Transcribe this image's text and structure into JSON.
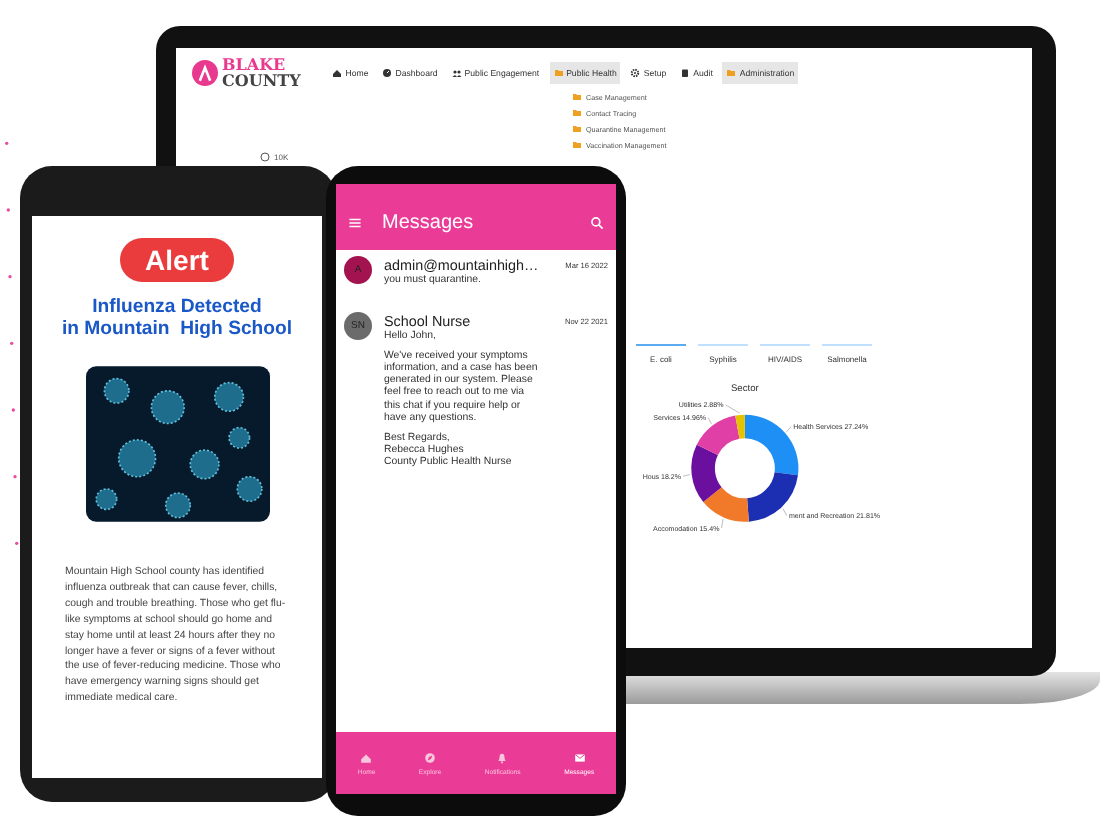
{
  "laptop": {
    "logo": {
      "line_1": "BLAKE",
      "line_2": "COUNTY"
    },
    "nav": [
      {
        "label": "Home",
        "selected": false
      },
      {
        "label": "Dashboard",
        "selected": false
      },
      {
        "label": "Public Engagement",
        "selected": false
      },
      {
        "label": "Public Health",
        "selected": true
      },
      {
        "label": "Setup",
        "selected": false
      },
      {
        "label": "Audit",
        "selected": false
      },
      {
        "label": "Administration",
        "selected": true
      }
    ],
    "dropdown": [
      "Case Management",
      "Contact Tracing",
      "Quarantine Management",
      "Vaccination Management"
    ],
    "stat_label": "10K",
    "tabs": [
      {
        "label": "E. coli",
        "selected": true
      },
      {
        "label": "Syphilis",
        "selected": false
      },
      {
        "label": "HIV/AIDS",
        "selected": false
      },
      {
        "label": "Salmonella",
        "selected": false
      }
    ],
    "chart_data": {
      "type": "donut",
      "title": "Sector",
      "categories": [
        "Health Services",
        "ment and Recreation",
        "Accomodation",
        "Hous",
        "Services",
        "Utilities"
      ],
      "values": [
        27.24,
        21.81,
        15.4,
        18.2,
        14.96,
        2.88
      ],
      "value_labels": [
        "27.24%",
        "21.81%",
        "15.4%",
        "18.2%",
        "14.96%",
        "2.88%"
      ]
    }
  },
  "alert_phone": {
    "badge": "Alert",
    "headline": [
      "Influenza Detected",
      "in Mountain  High School"
    ],
    "body": "Mountain High School county has identified influenza outbreak that can cause fever, chills, cough and trouble breathing. Those who get flu-like symptoms at school should go home and stay home until at least 24 hours after they no longer have a fever or signs of a fever without the use of fever-reducing medicine. Those who have emergency warning signs should get immediate medical care."
  },
  "messages_phone": {
    "title": "Messages",
    "messages": [
      {
        "avatar": "A",
        "color": "#a3134f",
        "sender": "admin@mountainhigh…",
        "date": "Mar 16 2022",
        "paragraphs": [
          [
            "you must quarantine."
          ]
        ]
      },
      {
        "avatar": "SN",
        "color": "#6b6b6b",
        "sender": "School Nurse",
        "date": "Nov 22 2021",
        "paragraphs": [
          [
            "Hello John,"
          ],
          [
            "We've received your symptoms information, and a case has been generated in our system. Please feel free to reach out to me via this chat if you require help or have any questions."
          ],
          [
            "Best Regards,",
            "Rebecca Hughes",
            "County Public Health Nurse"
          ]
        ]
      }
    ],
    "nav": [
      {
        "label": "Home",
        "selected": false
      },
      {
        "label": "Explore",
        "selected": false
      },
      {
        "label": "Notifications",
        "selected": false
      },
      {
        "label": "Messages",
        "selected": true
      }
    ]
  }
}
